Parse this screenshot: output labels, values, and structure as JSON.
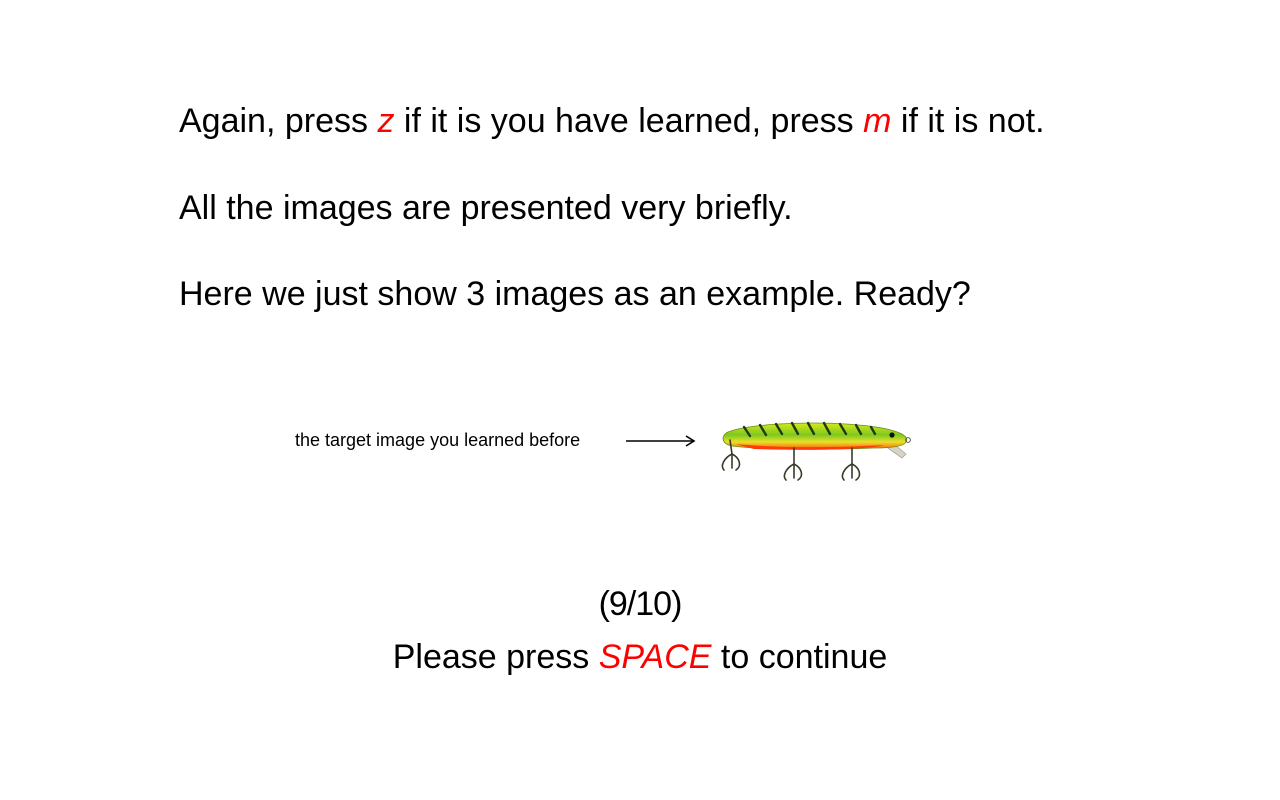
{
  "instructions": {
    "line1": {
      "part1": "Again, press ",
      "key1": "z",
      "part2": " if it is you have learned, press ",
      "key2": "m",
      "part3": " if it is not."
    },
    "line2": "All the images are presented very briefly.",
    "line3": "Here we just show 3 images as an example. Ready?"
  },
  "target": {
    "label": "the target image you learned before",
    "image": "fishing-lure"
  },
  "progress": "(9/10)",
  "continue_prompt": {
    "before": "Please press ",
    "key": "SPACE",
    "after": " to continue"
  },
  "colors": {
    "text": "#000000",
    "key_highlight": "#ff0000",
    "background": "#ffffff"
  }
}
